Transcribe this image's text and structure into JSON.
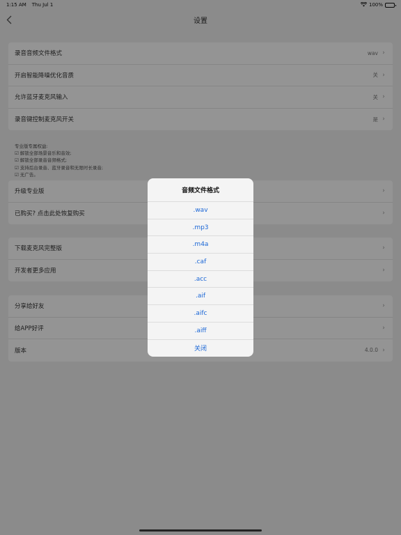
{
  "status_bar": {
    "time": "1:15 AM",
    "date": "Thu Jul 1",
    "battery": "100%"
  },
  "nav": {
    "title": "设置"
  },
  "settings_group": [
    {
      "label": "录音音频文件格式",
      "value": "wav"
    },
    {
      "label": "开启智能降噪优化音质",
      "value": "关"
    },
    {
      "label": "允许蓝牙麦克风输入",
      "value": "关"
    },
    {
      "label": "录音键控制麦克风开关",
      "value": "是"
    }
  ],
  "pro_notes": {
    "heading": "专业版专属权益:",
    "items": [
      "☑ 解锁全部场景音乐和音效;",
      "☑ 解锁全部录音音频格式;",
      "☑ 支持后台录音、蓝牙录音和无限时长录音;",
      "☑ 无广告。"
    ]
  },
  "purchase_group": [
    {
      "label": "升级专业版"
    },
    {
      "label": "已购买? 点击此处恢复购买"
    }
  ],
  "apps_group": [
    {
      "label": "下载麦克风完整版"
    },
    {
      "label": "开发者更多应用"
    }
  ],
  "about_group": [
    {
      "label": "分享给好友",
      "value": ""
    },
    {
      "label": "给APP好评",
      "value": ""
    },
    {
      "label": "版本",
      "value": "4.0.0"
    }
  ],
  "dialog": {
    "title": "音频文件格式",
    "options": [
      ".wav",
      ".mp3",
      ".m4a",
      ".caf",
      ".acc",
      ".aif",
      ".aifc",
      ".aiff"
    ],
    "close": "关闭"
  }
}
